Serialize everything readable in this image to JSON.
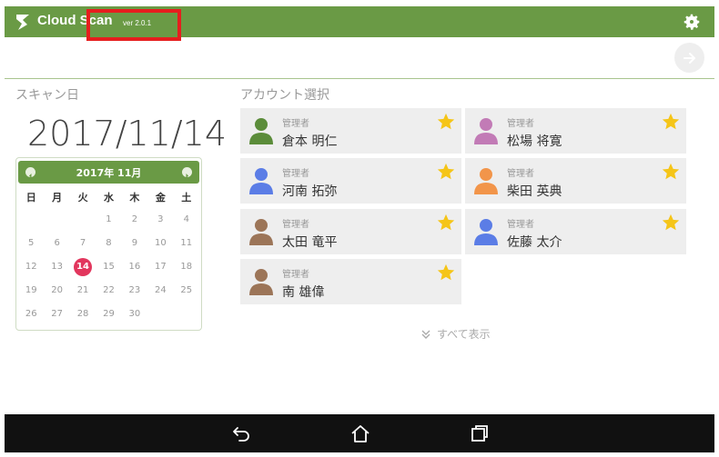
{
  "header": {
    "app_title": "Cloud Scan",
    "version": "ver 2.0.1"
  },
  "scan": {
    "label": "スキャン日",
    "date": "2017/11/14"
  },
  "calendar": {
    "title": "2017年 11月",
    "weekdays": [
      "日",
      "月",
      "火",
      "水",
      "木",
      "金",
      "土"
    ],
    "days": [
      "",
      "",
      "",
      "1",
      "2",
      "3",
      "4",
      "5",
      "6",
      "7",
      "8",
      "9",
      "10",
      "11",
      "12",
      "13",
      "14",
      "15",
      "16",
      "17",
      "18",
      "19",
      "20",
      "21",
      "22",
      "23",
      "24",
      "25",
      "26",
      "27",
      "28",
      "29",
      "30",
      "",
      ""
    ],
    "selected": "14"
  },
  "accounts": {
    "label": "アカウント選択",
    "items": [
      {
        "role": "管理者",
        "name": "倉本 明仁",
        "avatar_color": "#5b8c3a"
      },
      {
        "role": "管理者",
        "name": "松場 将寛",
        "avatar_color": "#c27bb6"
      },
      {
        "role": "管理者",
        "name": "河南 拓弥",
        "avatar_color": "#5b7de6"
      },
      {
        "role": "管理者",
        "name": "柴田 英典",
        "avatar_color": "#f2954a"
      },
      {
        "role": "管理者",
        "name": "太田 竜平",
        "avatar_color": "#9c7558"
      },
      {
        "role": "管理者",
        "name": "佐藤 太介",
        "avatar_color": "#5b7de6"
      },
      {
        "role": "管理者",
        "name": "南 雄偉",
        "avatar_color": "#9c7558"
      }
    ],
    "show_all": "すべて表示"
  },
  "colors": {
    "brand": "#6a9a45",
    "star": "#f5c518",
    "selected_day": "#e2365d",
    "highlight_box": "#e61e1e"
  },
  "icons": {
    "logo": "cloud-scan-logo-icon",
    "settings": "gear-icon",
    "next": "arrow-right-icon",
    "favorite": "star-icon",
    "show_all": "double-chevron-down-icon",
    "nav_back": "back-icon",
    "nav_home": "home-icon",
    "nav_recent": "recent-apps-icon"
  }
}
